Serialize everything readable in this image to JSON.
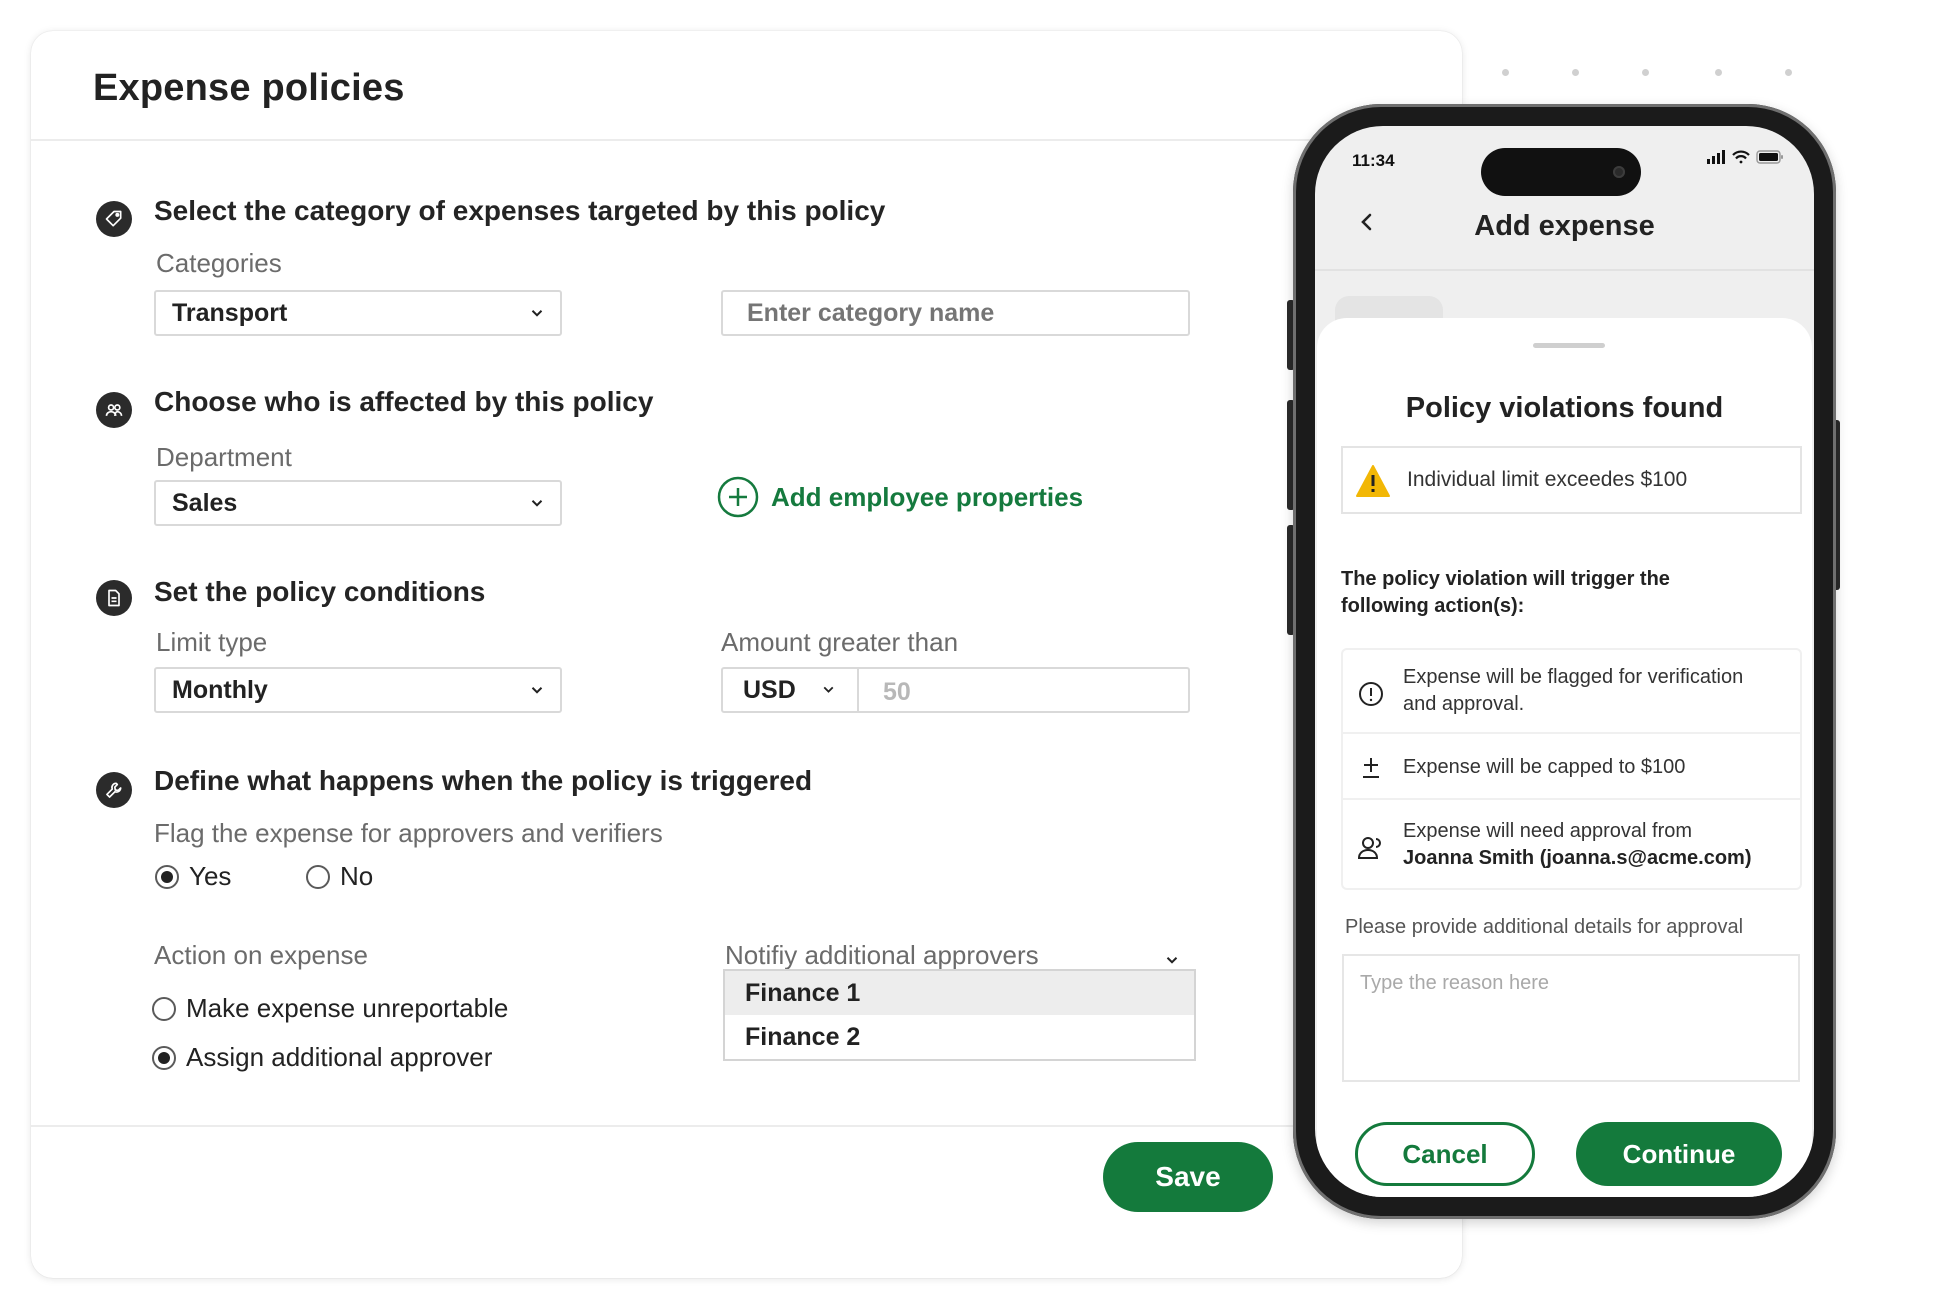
{
  "colors": {
    "accent": "#147a3c",
    "warning": "#f2b705",
    "text": "#222222",
    "muted": "#6b6b6b"
  },
  "page": {
    "title": "Expense policies"
  },
  "sections": {
    "category": {
      "title": "Select the category of expenses targeted by this policy",
      "icon": "tag-icon",
      "label": "Categories",
      "selected": "Transport",
      "name_placeholder": "Enter category name"
    },
    "affected": {
      "title": "Choose who is affected by this policy",
      "icon": "people-icon",
      "label": "Department",
      "selected": "Sales",
      "add_label": "Add employee properties"
    },
    "conditions": {
      "title": "Set the policy conditions",
      "icon": "document-icon",
      "limit_label": "Limit type",
      "limit_selected": "Monthly",
      "amount_label": "Amount greater than",
      "currency": "USD",
      "amount_value": "50"
    },
    "trigger": {
      "title": "Define what happens when the policy is triggered",
      "icon": "wrench-icon",
      "flag_label": "Flag the expense for approvers and verifiers",
      "flag_options": [
        "Yes",
        "No"
      ],
      "flag_selected": "Yes",
      "action_label": "Action on expense",
      "action_options": [
        "Make expense unreportable",
        "Assign additional approver"
      ],
      "action_selected": "Assign additional approver",
      "notify_label": "Notifiy additional approvers",
      "approvers": [
        "Finance 1",
        "Finance 2"
      ],
      "approvers_highlighted": "Finance 1"
    }
  },
  "footer": {
    "save_label": "Save"
  },
  "phone": {
    "status_time": "11:34",
    "nav_title": "Add expense",
    "sheet": {
      "title": "Policy violations found",
      "warning": "Individual limit exceedes $100",
      "trigger_text": "The policy violation will trigger the following action(s):",
      "actions": [
        {
          "icon": "alert-circle-icon",
          "line1": "Expense will be flagged for verification",
          "line2": "and approval."
        },
        {
          "icon": "plus-minus-icon",
          "line1": "Expense will be capped to $100"
        },
        {
          "icon": "user-check-icon",
          "line1": "Expense will need approval from",
          "line2": "Joanna Smith (joanna.s@acme.com)"
        }
      ],
      "details_label": "Please provide additional details for approval",
      "reason_placeholder": "Type the reason here",
      "cancel_label": "Cancel",
      "continue_label": "Continue"
    }
  }
}
